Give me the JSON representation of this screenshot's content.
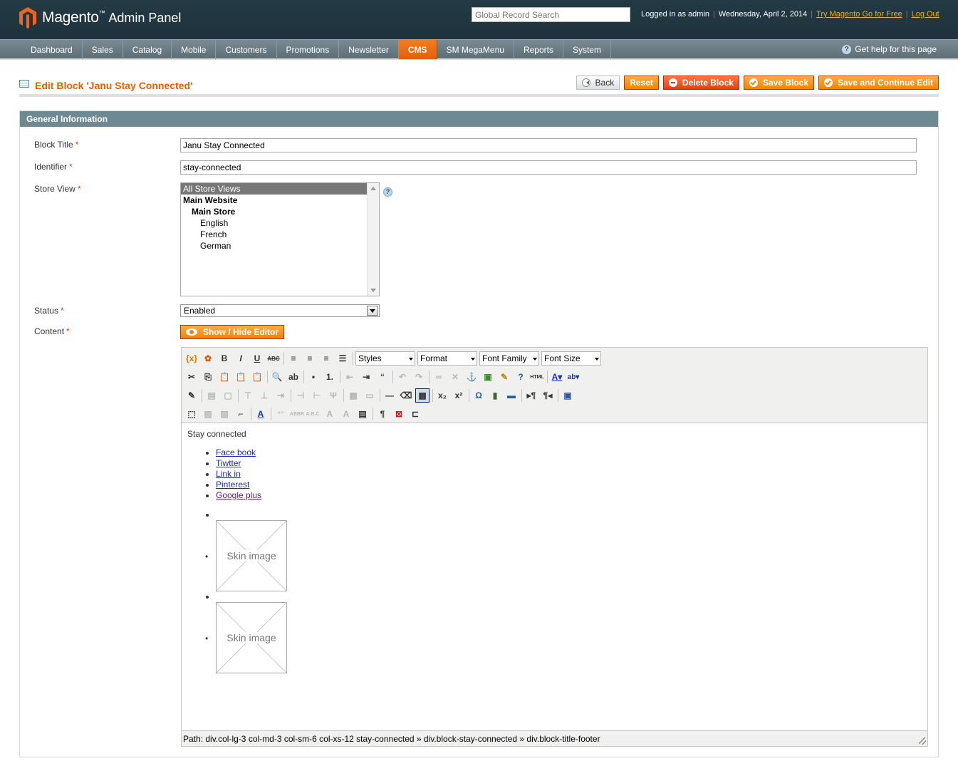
{
  "header": {
    "brand": "Magento",
    "brand_tm": "™",
    "panel": "Admin Panel",
    "search_placeholder": "Global Record Search",
    "logged_in": "Logged in as admin",
    "date": "Wednesday, April 2, 2014",
    "try_link": "Try Magento Go for Free",
    "logout": "Log Out"
  },
  "nav": {
    "items": [
      "Dashboard",
      "Sales",
      "Catalog",
      "Mobile",
      "Customers",
      "Promotions",
      "Newsletter",
      "CMS",
      "SM MegaMenu",
      "Reports",
      "System"
    ],
    "active": "CMS",
    "help": "Get help for this page"
  },
  "page": {
    "title": "Edit Block 'Janu Stay Connected'",
    "buttons": {
      "back": "Back",
      "reset": "Reset",
      "delete": "Delete Block",
      "save": "Save Block",
      "save_continue": "Save and Continue Edit"
    }
  },
  "form": {
    "section": "General Information",
    "block_title_label": "Block Title",
    "block_title_value": "Janu Stay Connected",
    "identifier_label": "Identifier",
    "identifier_value": "stay-connected",
    "store_view_label": "Store View",
    "store_views": [
      "All Store Views",
      "Main Website",
      "Main Store",
      "English",
      "French",
      "German"
    ],
    "status_label": "Status",
    "status_value": "Enabled",
    "content_label": "Content",
    "show_hide": "Show / Hide Editor",
    "required": "*"
  },
  "editor": {
    "styles": "Styles",
    "format": "Format",
    "font_family": "Font Family",
    "font_size": "Font Size",
    "heading": "Stay connected",
    "links": [
      "Face book",
      "Tiwtter",
      "Link in",
      "Pinterest",
      "Google plus"
    ],
    "skin_image": "Skin image",
    "path": "Path: div.col-lg-3 col-md-3 col-sm-6 col-xs-12 stay-connected » div.block-stay-connected » div.block-title-footer"
  }
}
